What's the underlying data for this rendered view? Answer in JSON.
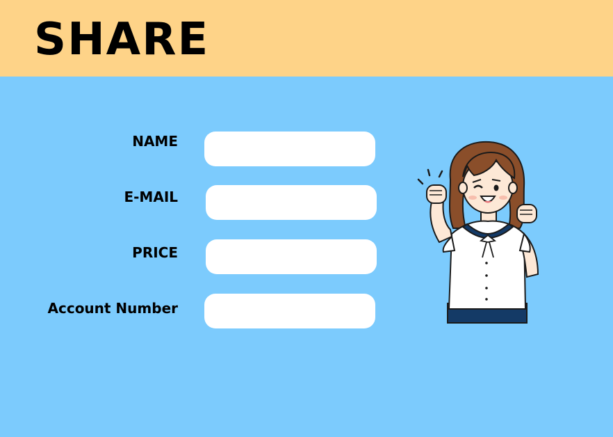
{
  "header": {
    "title": "SHARE",
    "background": "#fed388"
  },
  "form": {
    "background": "#7ccbfd",
    "fields": [
      {
        "label": "NAME",
        "value": "",
        "placeholder": ""
      },
      {
        "label": "E-MAIL",
        "value": "",
        "placeholder": ""
      },
      {
        "label": "PRICE",
        "value": "",
        "placeholder": ""
      },
      {
        "label": "Account Number",
        "value": "",
        "placeholder": ""
      }
    ]
  },
  "illustration": {
    "icon": "cheering-girl-illustration"
  }
}
